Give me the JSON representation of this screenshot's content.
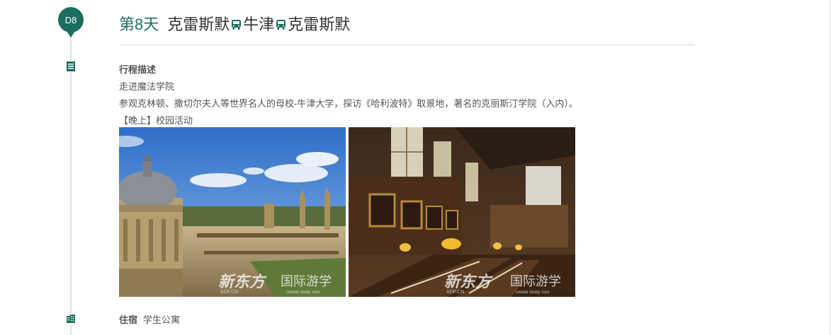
{
  "day": {
    "badge": "D8",
    "label": "第8天",
    "route": [
      "克雷斯默",
      "牛津",
      "克雷斯默"
    ]
  },
  "itinerary": {
    "heading": "行程描述",
    "subtitle": "走进魔法学院",
    "description": "参观克林顿、撒切尔夫人等世界名人的母校-牛津大学，探访《哈利波特》取景地，著名的克丽斯汀学院（入内）。",
    "evening": "【晚上】校园活动"
  },
  "photos": {
    "watermark_brand": "新东方",
    "watermark_sub": "XDF.CN",
    "watermark_text": "国际游学",
    "watermark_small": "Global Study Tour"
  },
  "accommodation": {
    "label": "住宿",
    "value": "学生公寓"
  },
  "colors": {
    "accent": "#1a6e60",
    "text": "#555555",
    "divider": "#dcdcdc"
  }
}
